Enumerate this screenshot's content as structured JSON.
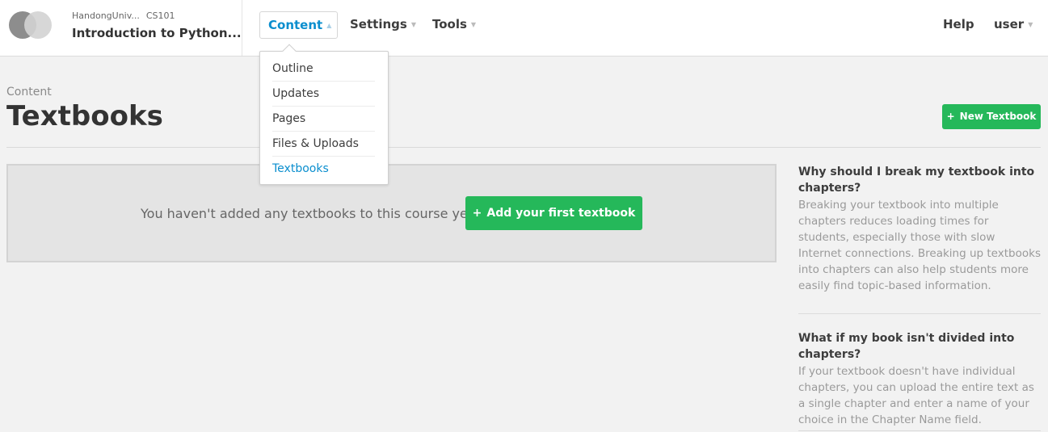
{
  "header": {
    "org": "HandongUniv...",
    "course_number": "CS101",
    "course_title": "Introduction to Python...",
    "nav": {
      "content": "Content",
      "settings": "Settings",
      "tools": "Tools",
      "help": "Help",
      "user": "user"
    }
  },
  "dropdown": {
    "items": [
      "Outline",
      "Updates",
      "Pages",
      "Files & Uploads",
      "Textbooks"
    ],
    "active": "Textbooks"
  },
  "page": {
    "breadcrumb": "Content",
    "title": "Textbooks",
    "new_button": "New Textbook"
  },
  "empty_state": {
    "message": "You haven't added any textbooks to this course yet.",
    "button": "Add your first textbook"
  },
  "help": [
    {
      "question": "Why should I break my textbook into chapters?",
      "answer": "Breaking your textbook into multiple chapters reduces loading times for students, especially those with slow Internet connections. Breaking up textbooks into chapters can also help students more easily find topic-based information."
    },
    {
      "question": "What if my book isn't divided into chapters?",
      "answer": "If your textbook doesn't have individual chapters, you can upload the entire text as a single chapter and enter a name of your choice in the Chapter Name field."
    }
  ],
  "colors": {
    "accent_blue": "#0a8ece",
    "button_green": "#25b85a"
  }
}
